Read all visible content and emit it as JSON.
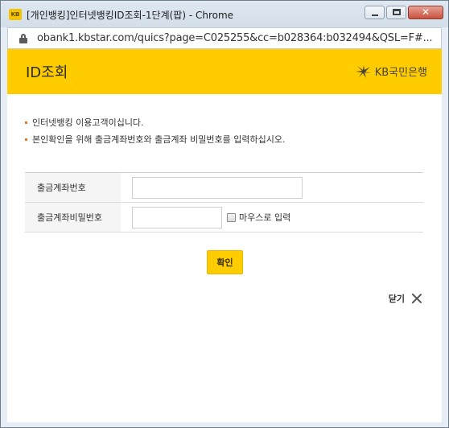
{
  "window": {
    "title": "[개인뱅킹]인터넷뱅킹ID조회-1단계(팝) - Chrome",
    "app_icon_text": "KB",
    "controls": {
      "minimize": "minimize",
      "maximize": "maximize",
      "close": "✕"
    }
  },
  "address_bar": {
    "url": "obank1.kbstar.com/quics?page=C025255&cc=b028364:b032494&QSL=F#..."
  },
  "header": {
    "title": "ID조회",
    "brand": "KB국민은행",
    "background": "#ffcc00"
  },
  "notices": [
    "인터넷뱅킹 이용고객이십니다.",
    "본인확인을 위해 출금계좌번호와 출금계좌 비밀번호를 입력하십시오."
  ],
  "form": {
    "account_label": "출금계좌번호",
    "account_value": "",
    "password_label": "출금계좌비밀번호",
    "password_value": "",
    "mouse_input_label": "마우스로 입력"
  },
  "confirm_label": "확인",
  "close_label": "닫기"
}
